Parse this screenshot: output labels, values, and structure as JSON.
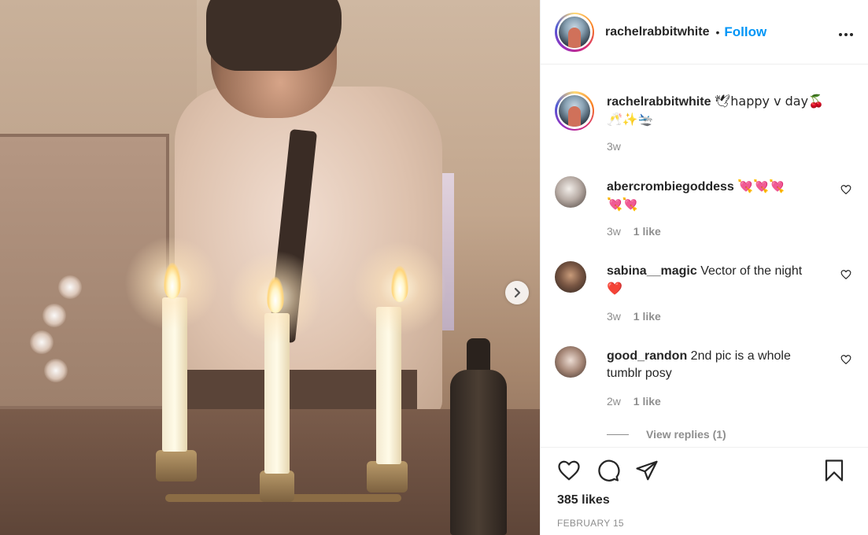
{
  "post": {
    "username": "rachelrabbitwhite",
    "follow_label": "Follow",
    "separator": "•",
    "more_label": "•••"
  },
  "caption": {
    "username": "rachelrabbitwhite",
    "text": "🕊happy v day🍒",
    "text_line2": "🥂✨🛬",
    "time": "3w"
  },
  "comments": [
    {
      "username": "abercrombiegoddess",
      "text": "💘💘💘",
      "text_line2": "💘💘",
      "time": "3w",
      "likes": "1 like"
    },
    {
      "username": "sabina__magic",
      "text": "Vector of the night",
      "text_line2": "❤️",
      "time": "3w",
      "likes": "1 like"
    },
    {
      "username": "good_randon",
      "text": "2nd pic is a whole",
      "text_line2": "tumblr posy",
      "time": "2w",
      "likes": "1 like"
    }
  ],
  "view_replies": "View replies (1)",
  "likes_count": "385 likes",
  "date": "FEBRUARY 15",
  "colors": {
    "follow": "#0095f6",
    "text": "#262626",
    "muted": "#8e8e8e",
    "border": "#efefef"
  },
  "icons": {
    "next": "chevron-right-icon",
    "like": "heart-icon",
    "comment": "comment-bubble-icon",
    "share": "paper-plane-icon",
    "save": "bookmark-icon",
    "more": "ellipsis-icon"
  }
}
